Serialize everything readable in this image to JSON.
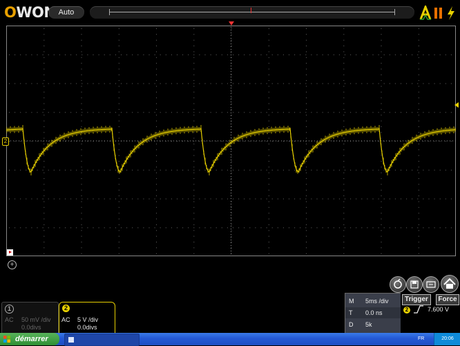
{
  "header": {
    "logo": "OWON",
    "mode_button": "Auto"
  },
  "icons": {
    "trigger_status": "a-trigger-icon",
    "pause": "pause-icon",
    "power": "lightning-icon",
    "toolbar": [
      "autoset-icon",
      "save-icon",
      "screen-icon",
      "home-icon"
    ],
    "zoom": "plus-circle-icon"
  },
  "channel1": {
    "num": "1",
    "coupling": "AC",
    "scale": "50 mV /div",
    "offset": "0.0divs"
  },
  "channel2": {
    "num": "2",
    "coupling": "AC",
    "scale": "5 V /div",
    "offset": "0.0divs"
  },
  "measurements": {
    "rows": [
      {
        "key": "M",
        "value": "5ms /div"
      },
      {
        "key": "T",
        "value": "0.0 ns"
      },
      {
        "key": "D",
        "value": "5k"
      }
    ]
  },
  "trigger": {
    "trigger_button": "Trigger",
    "force_button": "Force",
    "channel": "2",
    "edge": "rising-edge-icon",
    "level": "7.600 V"
  },
  "taskbar": {
    "start_label": "démarrer",
    "task_label": "",
    "language": "FR",
    "clock": "20:06"
  },
  "colors": {
    "channel2": "#e8d000",
    "trigger_marker": "#e33",
    "background": "#000000",
    "taskbar": "#2358d4"
  }
}
